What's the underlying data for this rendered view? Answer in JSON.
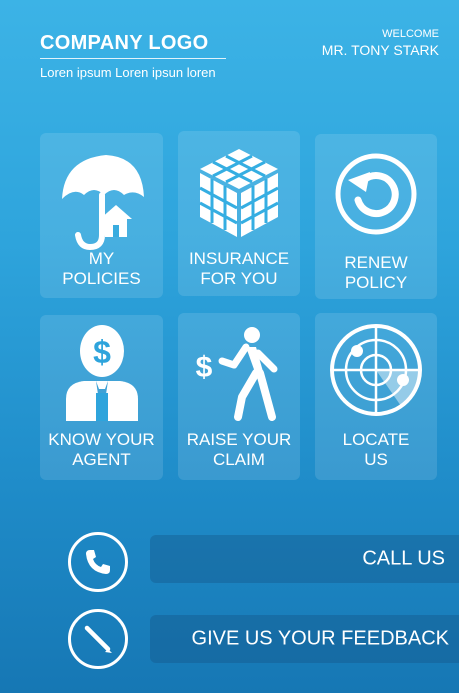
{
  "header": {
    "logo": "COMPANY LOGO",
    "tagline": "Loren ipsum Loren ipsun loren",
    "welcome": "WELCOME",
    "user_name": "MR. TONY STARK"
  },
  "tiles": [
    {
      "label": "MY\nPOLICIES",
      "icon": "umbrella-house-icon"
    },
    {
      "label": "INSURANCE\nFOR YOU",
      "icon": "cube-icon"
    },
    {
      "label": "RENEW\nPOLICY",
      "icon": "refresh-icon"
    },
    {
      "label": "KNOW YOUR\nAGENT",
      "icon": "agent-dollar-icon"
    },
    {
      "label": "RAISE YOUR\nCLAIM",
      "icon": "walking-dollar-icon"
    },
    {
      "label": "LOCATE\nUS",
      "icon": "radar-icon"
    }
  ],
  "actions": {
    "call": {
      "label": "CALL US",
      "icon": "phone-icon"
    },
    "feedback": {
      "label": "GIVE US YOUR FEEDBACK",
      "icon": "pencil-icon"
    }
  },
  "colors": {
    "background_top": "#3cb3e6",
    "background_bottom": "#1677b4",
    "text": "#ffffff"
  }
}
